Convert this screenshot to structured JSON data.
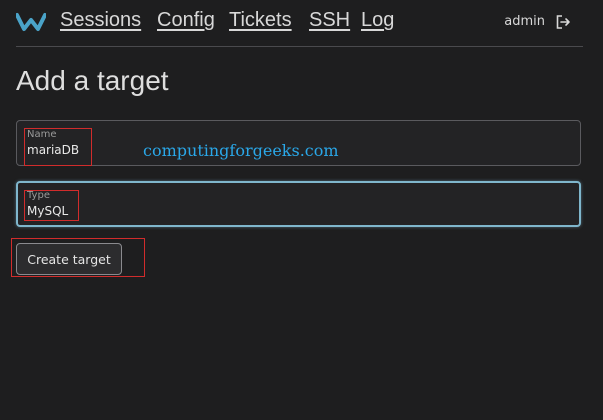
{
  "nav": {
    "logo": "warpgate-logo-icon",
    "links": [
      "Sessions",
      "Config",
      "Tickets",
      "SSH",
      "Log"
    ],
    "username": "admin",
    "logout_icon": "logout-icon"
  },
  "page": {
    "title": "Add a target"
  },
  "form": {
    "name": {
      "label": "Name",
      "value": "mariaDB"
    },
    "type": {
      "label": "Type",
      "value": "MySQL"
    },
    "submit_label": "Create target"
  },
  "watermark": "computingforgeeks.com",
  "colors": {
    "background": "#1e1e1f",
    "focus_border": "#7fb6cc",
    "annotation": "#d12c2c",
    "watermark": "#2aa7e8"
  }
}
